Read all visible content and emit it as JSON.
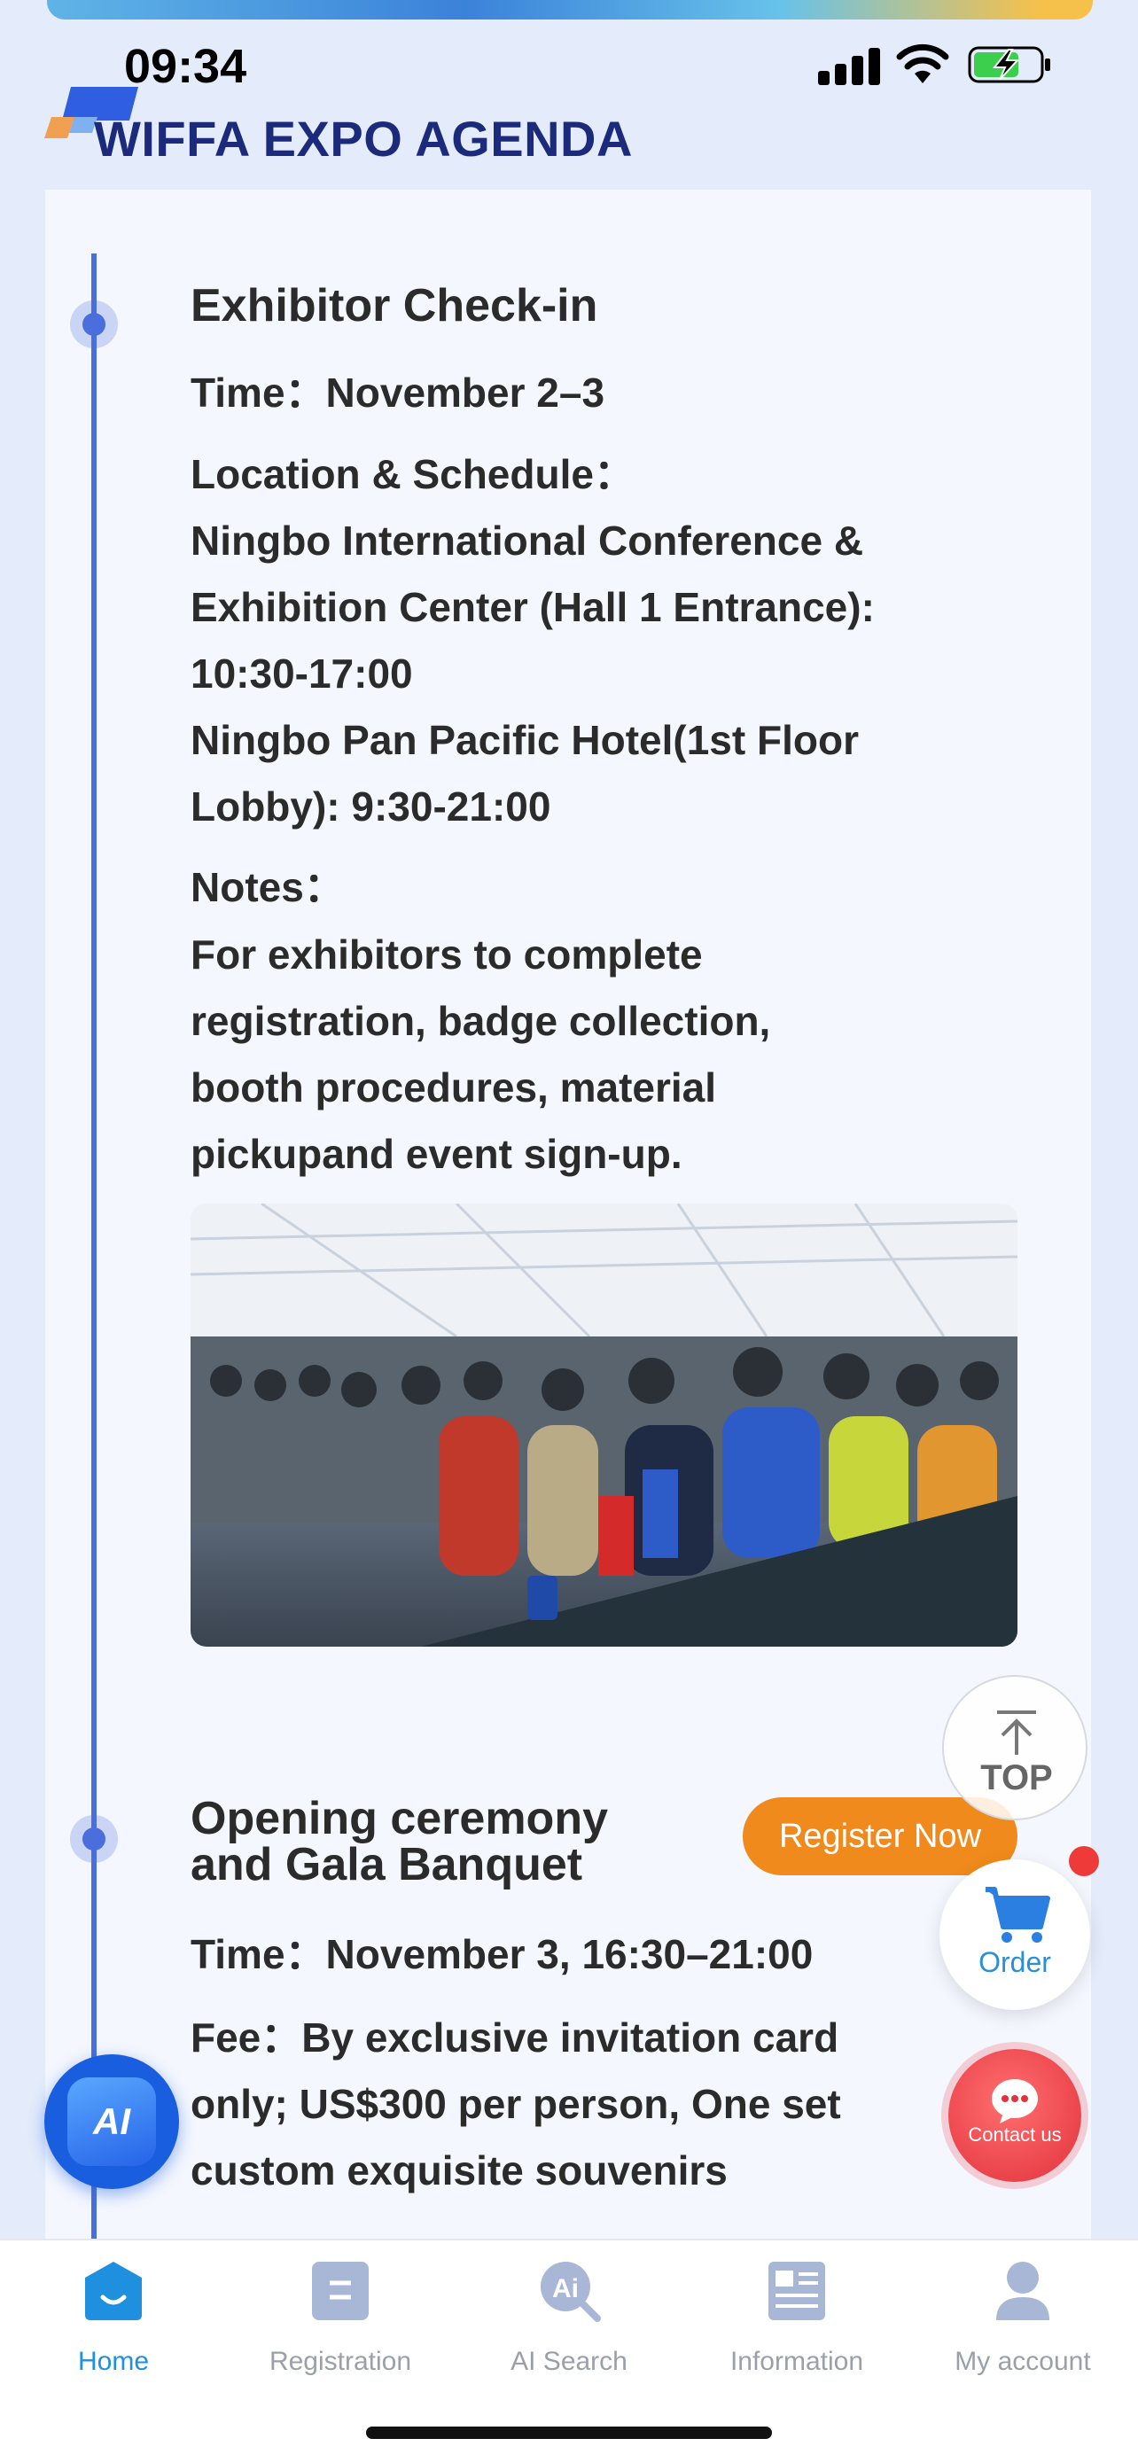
{
  "status_bar": {
    "time": "09:34"
  },
  "header": {
    "title": "WIFFA EXPO AGENDA"
  },
  "events": [
    {
      "title": "Exhibitor Check-in",
      "time_label": "Time：",
      "time_value": "November 2–3",
      "location_label": "Location & Schedule：",
      "location_lines": [
        "Ningbo International Conference &",
        "Exhibition Center (Hall 1 Entrance):",
        "10:30-17:00",
        "Ningbo Pan Pacific Hotel(1st Floor",
        "Lobby): 9:30-21:00"
      ],
      "notes_label": "Notes：",
      "notes_lines": [
        "For exhibitors to complete",
        "registration, badge collection,",
        "booth procedures, material",
        "pickupand event sign-up."
      ]
    },
    {
      "title_lines": [
        "Opening ceremony",
        "and Gala Banquet"
      ],
      "register_label": "Register Now",
      "time_label": "Time：",
      "time_value": "November 3, 16:30–21:00",
      "fee_label": "Fee：",
      "fee_lines": [
        "By exclusive invitation card",
        "only; US$300 per person, One set",
        "custom exquisite souvenirs"
      ]
    }
  ],
  "floating": {
    "top_label": "TOP",
    "order_label": "Order",
    "contact_label": "Contact us",
    "ai_label": "AI"
  },
  "bottom_nav": [
    {
      "label": "Home",
      "icon": "home-icon",
      "active": true
    },
    {
      "label": "Registration",
      "icon": "registration-icon",
      "active": false
    },
    {
      "label": "AI Search",
      "icon": "ai-search-icon",
      "active": false
    },
    {
      "label": "Information",
      "icon": "information-icon",
      "active": false
    },
    {
      "label": "My account",
      "icon": "account-icon",
      "active": false
    }
  ],
  "colors": {
    "accent": "#4a6fdc",
    "register_button": "#f08a1c",
    "nav_active": "#1f8fe0",
    "title_blue": "#1c2a7c"
  }
}
